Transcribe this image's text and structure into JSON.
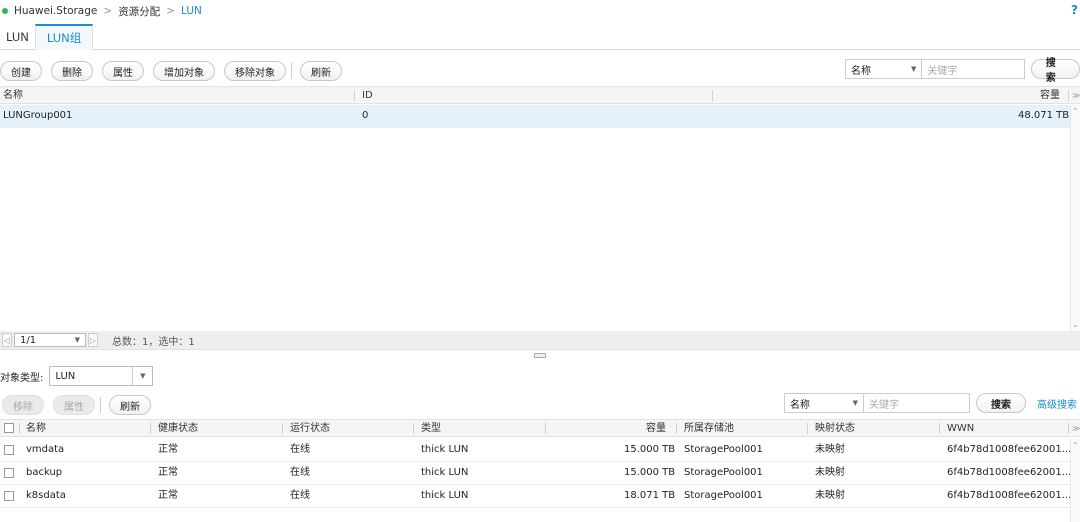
{
  "breadcrumb": {
    "items": [
      "Huawei.Storage",
      "资源分配",
      "LUN"
    ],
    "separator": ">"
  },
  "help_icon": "?",
  "tabs": [
    {
      "label": "LUN"
    },
    {
      "label": "LUN组"
    }
  ],
  "top_toolbar": {
    "buttons": [
      "创建",
      "删除",
      "属性",
      "增加对象",
      "移除对象",
      "刷新"
    ],
    "search_field": "名称",
    "search_placeholder": "关键字",
    "search_label": "搜索"
  },
  "top_table": {
    "columns": [
      "名称",
      "ID",
      "容量"
    ],
    "rows": [
      {
        "name": "LUNGroup001",
        "id": "0",
        "capacity": "48.071 TB"
      }
    ]
  },
  "pager": {
    "page": "1/1",
    "summary": "总数：1，选中：1"
  },
  "bottom": {
    "type_label": "对象类型:",
    "type_value": "LUN",
    "buttons": [
      "移除",
      "属性",
      "刷新"
    ],
    "search_field": "名称",
    "search_placeholder": "关键字",
    "search_label": "搜索",
    "advanced_search": "高级搜索",
    "columns": [
      "名称",
      "健康状态",
      "运行状态",
      "类型",
      "容量",
      "所属存储池",
      "映射状态",
      "WWN"
    ],
    "rows": [
      {
        "name": "vmdata",
        "health": "正常",
        "running": "在线",
        "type": "thick LUN",
        "capacity": "15.000 TB",
        "pool": "StoragePool001",
        "mapping": "未映射",
        "wwn": "6f4b78d1008fee62001..."
      },
      {
        "name": "backup",
        "health": "正常",
        "running": "在线",
        "type": "thick LUN",
        "capacity": "15.000 TB",
        "pool": "StoragePool001",
        "mapping": "未映射",
        "wwn": "6f4b78d1008fee62001..."
      },
      {
        "name": "k8sdata",
        "health": "正常",
        "running": "在线",
        "type": "thick LUN",
        "capacity": "18.071 TB",
        "pool": "StoragePool001",
        "mapping": "未映射",
        "wwn": "6f4b78d1008fee62001..."
      }
    ]
  },
  "colors": {
    "accent": "#1d8ad6",
    "selected_row": "#e6f2fb",
    "status_dot": "#2db84d"
  }
}
